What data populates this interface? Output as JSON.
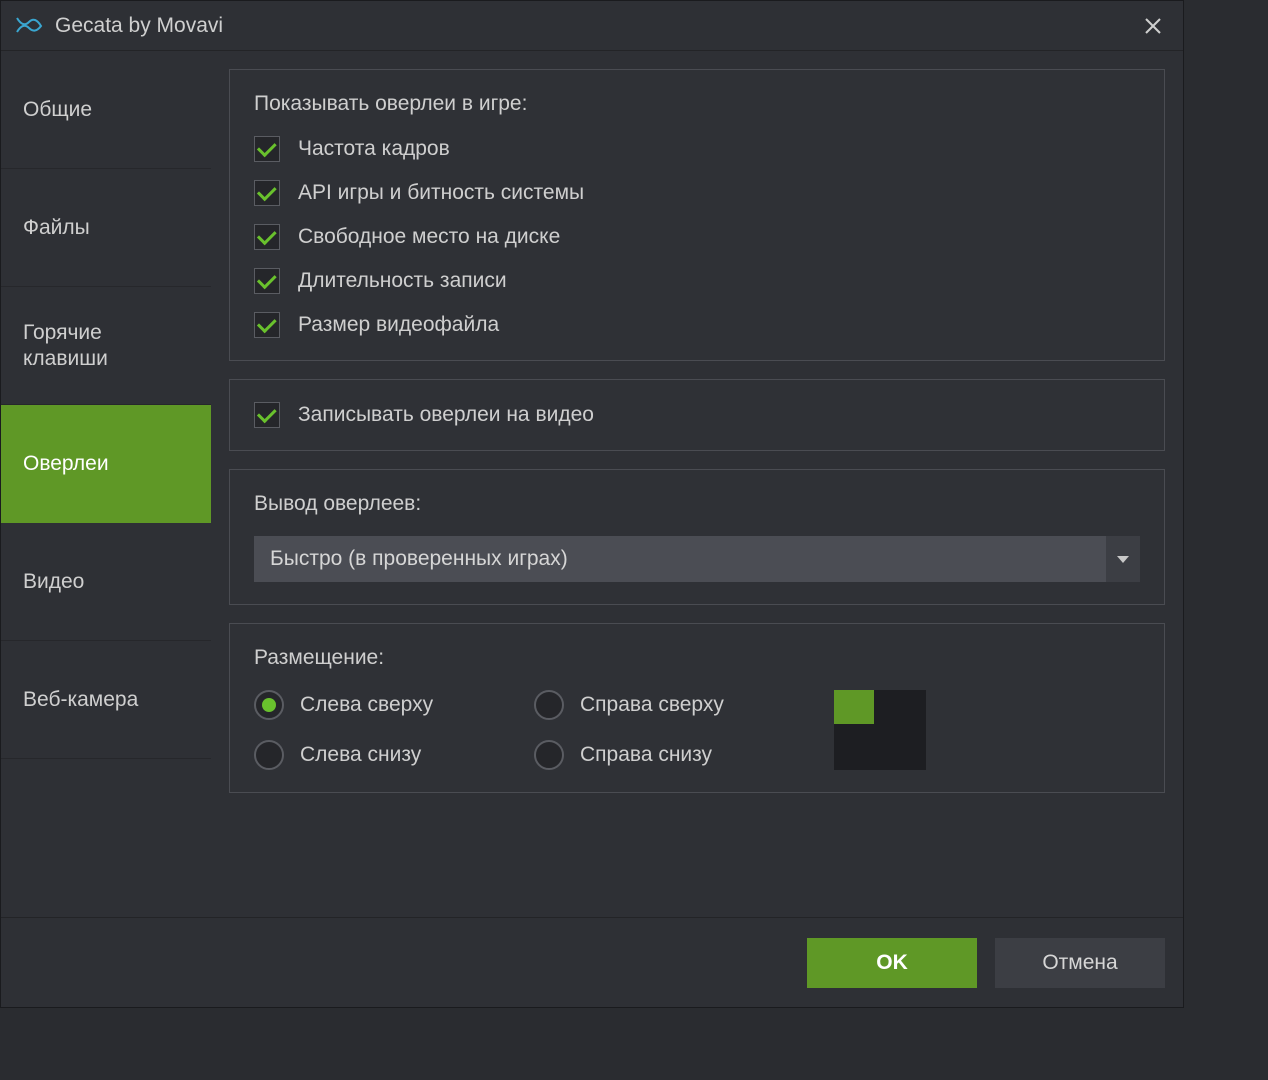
{
  "titlebar": {
    "title": "Gecata by Movavi"
  },
  "sidebar": {
    "items": [
      {
        "label": "Общие",
        "active": false
      },
      {
        "label": "Файлы",
        "active": false
      },
      {
        "label": "Горячие клавиши",
        "active": false
      },
      {
        "label": "Оверлеи",
        "active": true
      },
      {
        "label": "Видео",
        "active": false
      },
      {
        "label": "Веб-камера",
        "active": false
      }
    ]
  },
  "overlays": {
    "show_title": "Показывать оверлеи в игре:",
    "checks": {
      "framerate": "Частота кадров",
      "api_bitness": "API игры и битность системы",
      "free_space": "Свободное место на диске",
      "rec_duration": "Длительность записи",
      "file_size": "Размер видеофайла"
    },
    "record_overlays": "Записывать оверлеи на видео",
    "output_title": "Вывод оверлеев:",
    "output_selected": "Быстро (в проверенных играх)",
    "placement_title": "Размещение:",
    "placement": {
      "top_left": "Слева сверху",
      "top_right": "Справа сверху",
      "bottom_left": "Слева снизу",
      "bottom_right": "Справа снизу"
    }
  },
  "footer": {
    "ok": "OK",
    "cancel": "Отмена"
  },
  "colors": {
    "accent": "#5f9826",
    "check": "#69c12d",
    "bg": "#2e3035"
  }
}
